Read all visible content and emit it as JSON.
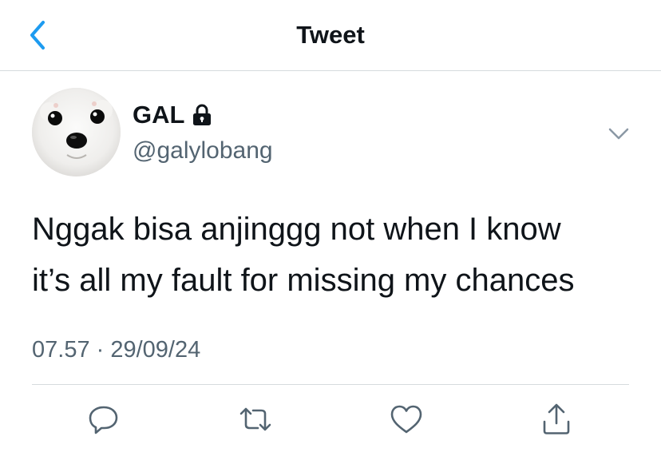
{
  "header": {
    "title": "Tweet",
    "back_icon": "chevron-left-icon"
  },
  "author": {
    "name": "GAL",
    "handle": "@galylobang",
    "protected_icon": "lock-icon",
    "avatar": "white dog photo"
  },
  "tweet": {
    "text_lines": [
      "Nggak bisa anjinggg not when I know",
      "it’s all my fault for missing my chances"
    ],
    "timestamp": "07.57 · 29/09/24"
  },
  "actions": [
    {
      "icon": "reply-icon"
    },
    {
      "icon": "retweet-icon"
    },
    {
      "icon": "like-icon"
    },
    {
      "icon": "share-icon"
    }
  ],
  "colors": {
    "accent": "#1d9bf0",
    "text": "#0f1419",
    "secondary_text": "#536471",
    "divider": "#d6dbde"
  }
}
